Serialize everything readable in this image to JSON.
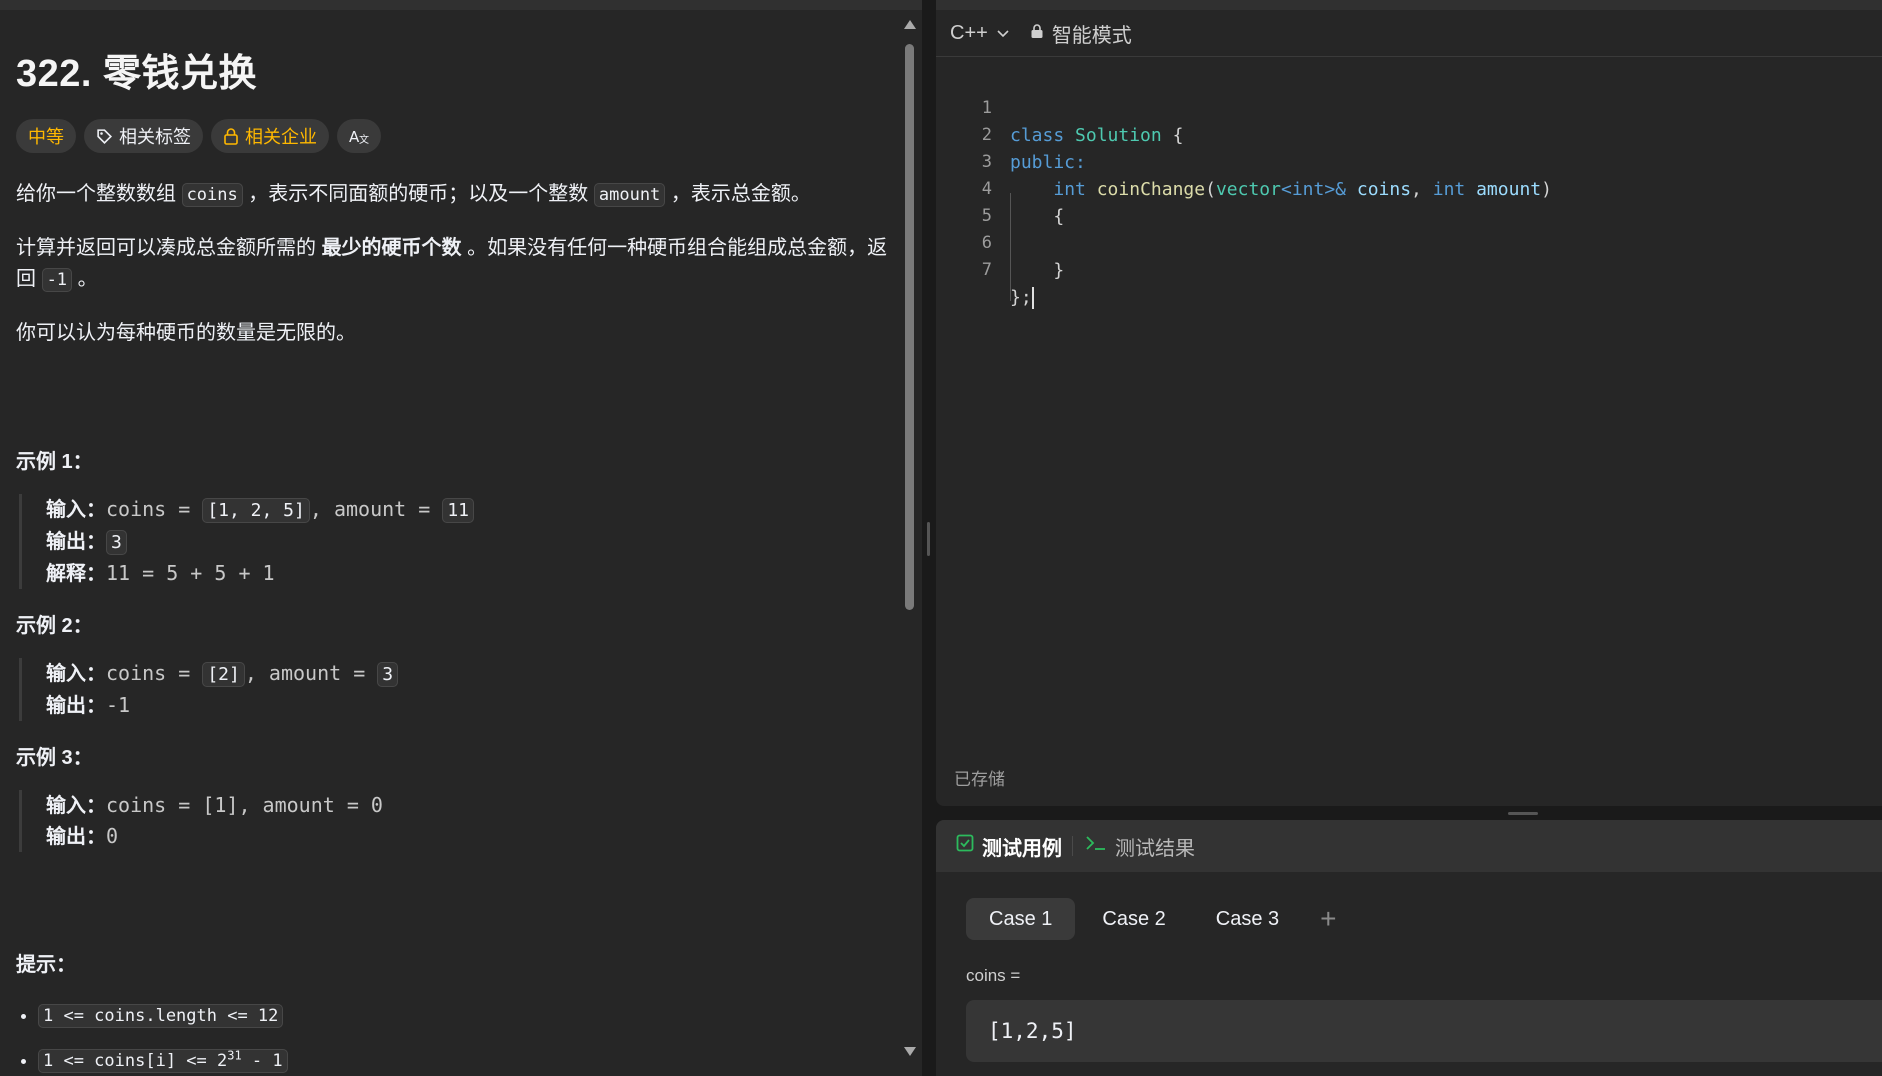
{
  "problem": {
    "title": "322. 零钱兑换",
    "tags": {
      "difficulty": "中等",
      "related_tags": "相关标签",
      "related_companies": "相关企业",
      "translate_icon_text": "A文"
    },
    "desc": {
      "p1_a": "给你一个整数数组 ",
      "p1_code1": "coins",
      "p1_b": " ，表示不同面额的硬币；以及一个整数 ",
      "p1_code2": "amount",
      "p1_c": " ，表示总金额。",
      "p2_a": "计算并返回可以凑成总金额所需的 ",
      "p2_bold": "最少的硬币个数",
      "p2_b": " 。如果没有任何一种硬币组合能组成总金额，返回 ",
      "p2_code": "-1",
      "p2_c": " 。",
      "p3": "你可以认为每种硬币的数量是无限的。"
    },
    "examples": [
      {
        "title": "示例 1：",
        "input_label": "输入：",
        "input_pre": "coins = ",
        "input_code1": "[1, 2, 5]",
        "input_mid": ", amount = ",
        "input_code2": "11",
        "output_label": "输出：",
        "output_code": "3",
        "explain_label": "解释：",
        "explain": "11 = 5 + 5 + 1"
      },
      {
        "title": "示例 2：",
        "input_label": "输入：",
        "input_pre": "coins = ",
        "input_code1": "[2]",
        "input_mid": ", amount = ",
        "input_code2": "3",
        "output_label": "输出：",
        "output": "-1"
      },
      {
        "title": "示例 3：",
        "input_label": "输入：",
        "input": "coins = [1], amount = 0",
        "output_label": "输出：",
        "output": "0"
      }
    ],
    "hints_title": "提示：",
    "hints": [
      {
        "text": "1 <= coins.length <= 12"
      },
      {
        "pre": "1 <= coins[i] <= 2",
        "sup": "31",
        "post": " - 1"
      }
    ]
  },
  "editor": {
    "language": "C++",
    "mode": "智能模式",
    "line_numbers": [
      "1",
      "2",
      "3",
      "4",
      "5",
      "6",
      "7"
    ],
    "code": {
      "l1_kw": "class",
      "l1_cls": "Solution",
      "l1_rest": " {",
      "l2_kw": "public:",
      "l3_indent": "    ",
      "l3_kw1": "int",
      "l3_fn": "coinChange",
      "l3_p1": "(",
      "l3_cls": "vector",
      "l3_lt": "<",
      "l3_kw2": "int",
      "l3_gt": ">&",
      "l3_var1": "coins",
      "l3_comma": ", ",
      "l3_kw3": "int",
      "l3_var2": "amount",
      "l3_p2": ")",
      "l4": "    {",
      "l5": "",
      "l6": "    }",
      "l7": "};"
    },
    "status": "已存储"
  },
  "testpanel": {
    "tab_cases": "测试用例",
    "tab_results": "测试结果",
    "cases": [
      "Case 1",
      "Case 2",
      "Case 3"
    ],
    "add": "+",
    "param_label": "coins =",
    "param_value": "[1,2,5]"
  }
}
